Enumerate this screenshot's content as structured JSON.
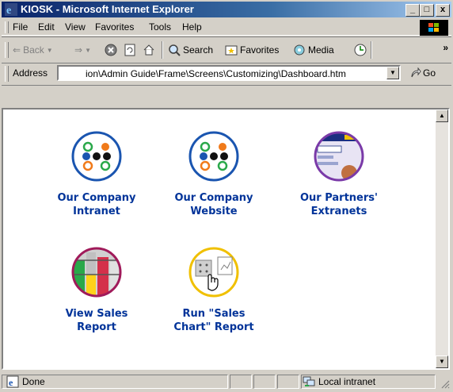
{
  "window": {
    "title": "KIOSK - Microsoft Internet Explorer",
    "controls": [
      "_",
      "□",
      "x"
    ]
  },
  "menu": [
    "File",
    "Edit",
    "View",
    "Favorites",
    "Tools",
    "Help"
  ],
  "toolbar": {
    "back_label": "Back",
    "search_label": "Search",
    "favorites_label": "Favorites",
    "media_label": "Media",
    "more_label": "»"
  },
  "address": {
    "label": "Address",
    "value": "ion\\Admin Guide\\Frame\\Screens\\Customizing\\Dashboard.htm",
    "go_label": "Go"
  },
  "tiles": [
    {
      "line1": "Our Company",
      "line2": "Intranet",
      "icon": "dots-logo-icon"
    },
    {
      "line1": "Our Company",
      "line2": "Website",
      "icon": "dots-logo-icon"
    },
    {
      "line1": "Our Partners'",
      "line2": "Extranets",
      "icon": "partner-screenshot-icon"
    },
    {
      "line1": "View Sales",
      "line2": "Report",
      "icon": "bar-report-icon"
    },
    {
      "line1": "Run \"Sales",
      "line2": "Chart\" Report",
      "icon": "run-report-icon"
    }
  ],
  "status": {
    "text": "Done",
    "zone": "Local intranet"
  }
}
